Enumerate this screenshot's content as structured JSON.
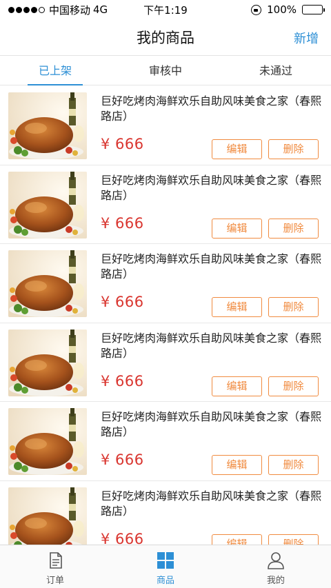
{
  "status_bar": {
    "carrier": "中国移动",
    "network": "4G",
    "time": "下午1:19",
    "battery": "100%"
  },
  "nav": {
    "title": "我的商品",
    "action": "新增"
  },
  "tabs": [
    {
      "label": "已上架",
      "active": true
    },
    {
      "label": "审核中",
      "active": false
    },
    {
      "label": "未通过",
      "active": false
    }
  ],
  "products": [
    {
      "title": "巨好吃烤肉海鲜欢乐自助风味美食之家（春熙路店）",
      "price": "¥ 666",
      "edit": "编辑",
      "delete": "删除"
    },
    {
      "title": "巨好吃烤肉海鲜欢乐自助风味美食之家（春熙路店）",
      "price": "¥ 666",
      "edit": "编辑",
      "delete": "删除"
    },
    {
      "title": "巨好吃烤肉海鲜欢乐自助风味美食之家（春熙路店）",
      "price": "¥ 666",
      "edit": "编辑",
      "delete": "删除"
    },
    {
      "title": "巨好吃烤肉海鲜欢乐自助风味美食之家（春熙路店）",
      "price": "¥ 666",
      "edit": "编辑",
      "delete": "删除"
    },
    {
      "title": "巨好吃烤肉海鲜欢乐自助风味美食之家（春熙路店）",
      "price": "¥ 666",
      "edit": "编辑",
      "delete": "删除"
    },
    {
      "title": "巨好吃烤肉海鲜欢乐自助风味美食之家（春熙路店）",
      "price": "¥ 666",
      "edit": "编辑",
      "delete": "删除"
    }
  ],
  "tabbar": [
    {
      "label": "订单",
      "icon": "document-icon",
      "active": false
    },
    {
      "label": "商品",
      "icon": "grid-icon",
      "active": true
    },
    {
      "label": "我的",
      "icon": "person-icon",
      "active": false
    }
  ],
  "colors": {
    "accent": "#2d8fd5",
    "price": "#d9352f",
    "button": "#f08a3e"
  }
}
